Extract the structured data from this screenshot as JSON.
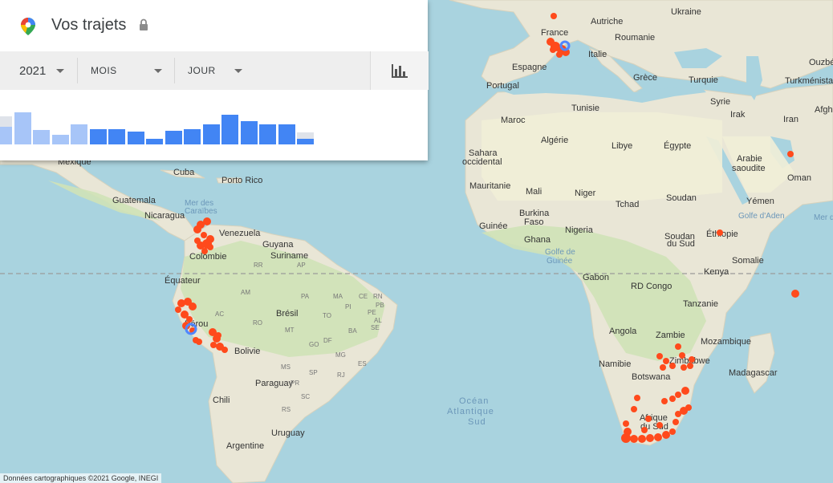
{
  "panel": {
    "title": "Vos trajets",
    "year": "2021",
    "month_placeholder": "MOIS",
    "day_placeholder": "JOUR"
  },
  "histogram": {
    "values": [
      0.55,
      1.0,
      0.45,
      0.3,
      0.62,
      0.47,
      0.47,
      0.4,
      0.18,
      0.42,
      0.47,
      0.62,
      0.93,
      0.72,
      0.63,
      0.62,
      0.18
    ],
    "light_values": [
      0.88,
      1.0,
      0.45,
      0.3,
      0.62,
      0.47,
      0.47,
      0.4,
      0.18,
      0.42,
      0.47,
      0.62,
      0.93,
      0.72,
      0.63,
      0.62,
      0.38
    ],
    "color_dark": "#4285f4",
    "color_light": "#a7c5f8"
  },
  "map": {
    "labels": {
      "france": "France",
      "autriche": "Autriche",
      "ukraine": "Ukraine",
      "roumanie": "Roumanie",
      "italie": "Italie",
      "espagne": "Espagne",
      "portugal": "Portugal",
      "grece": "Grèce",
      "turquie": "Turquie",
      "ouzbek": "Ouzbé",
      "turkmenista": "Turkménista",
      "afgh": "Afgh",
      "tunisie": "Tunisie",
      "syrie": "Syrie",
      "irak": "Irak",
      "iran": "Iran",
      "maroc": "Maroc",
      "algerie": "Algérie",
      "libye": "Libye",
      "egypte": "Égypte",
      "arabie1": "Arabie",
      "arabie2": "saoudite",
      "oman": "Oman",
      "sahara1": "Sahara",
      "sahara2": "occidental",
      "mauritanie": "Mauritanie",
      "mali": "Mali",
      "niger": "Niger",
      "tchad": "Tchad",
      "soudan": "Soudan",
      "yemen": "Yémen",
      "golfe_aden": "Golfe d'Aden",
      "mer_o": "Mer d",
      "burkina1": "Burkina",
      "burkina2": "Faso",
      "guinee": "Guinée",
      "nigeria": "Nigeria",
      "ghana": "Ghana",
      "golfe_guinee1": "Golfe de",
      "golfe_guinee2": "Guinée",
      "soudan_sud1": "Soudan",
      "soudan_sud2": "du Sud",
      "ethiopie": "Éthiopie",
      "somalie": "Somalie",
      "kenya": "Kenya",
      "gabon": "Gabon",
      "rd_congo": "RD Congo",
      "tanzanie": "Tanzanie",
      "angola": "Angola",
      "zambie": "Zambie",
      "mozambique": "Mozambique",
      "zimbabwe": "Zimbabwe",
      "namibie": "Namibie",
      "botswana": "Botswana",
      "madagascar": "Madagascar",
      "afrique_sud1": "Afrique",
      "afrique_sud2": "du Sud",
      "ocean1": "Océan",
      "ocean2": "Atlantique",
      "ocean3": "Sud",
      "mexique": "Mexique",
      "cuba": "Cuba",
      "porto_rico": "Porto Rico",
      "guatemala": "Guatemala",
      "nicaragua": "Nicaragua",
      "mer_caraibes1": "Mer des",
      "mer_caraibes2": "Caraïbes",
      "venezuela": "Venezuela",
      "guyana": "Guyana",
      "suriname": "Suriname",
      "colombie": "Colombie",
      "equateur": "Équateur",
      "bresil": "Brésil",
      "perou": "Pérou",
      "bolivie": "Bolivie",
      "paraguay": "Paraguay",
      "chili": "Chili",
      "uruguay": "Uruguay",
      "argentine": "Argentine",
      "rr": "RR",
      "ap": "AP",
      "am": "AM",
      "pa": "PA",
      "ac": "AC",
      "ro": "RO",
      "mt": "MT",
      "to": "TO",
      "ma": "MA",
      "pi": "PI",
      "ce": "CE",
      "rn": "RN",
      "pb": "PB",
      "pe": "PE",
      "al": "AL",
      "se": "SE",
      "ba": "BA",
      "go": "GO",
      "df": "DF",
      "mg": "MG",
      "ms": "MS",
      "es": "ES",
      "sp": "SP",
      "rj": "RJ",
      "pr": "PR",
      "sc": "SC",
      "rs": "RS"
    },
    "attribution": "Données cartographiques ©2021 Google, INEGI"
  }
}
